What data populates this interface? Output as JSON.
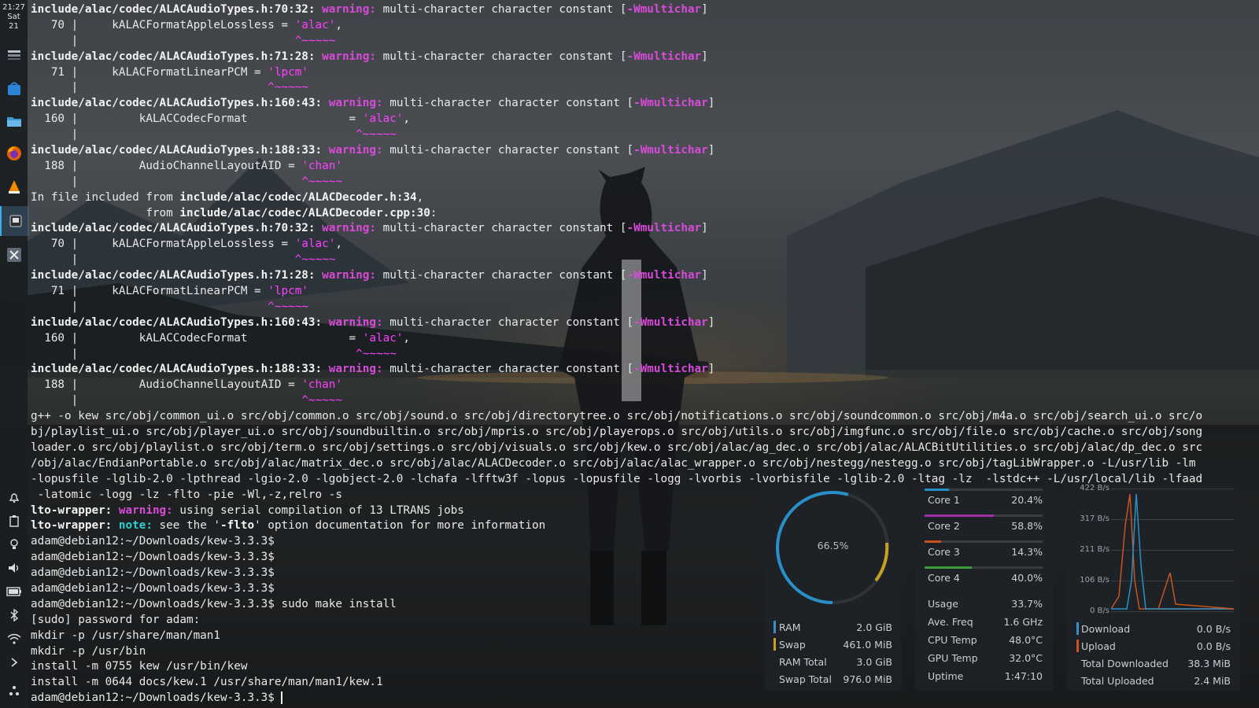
{
  "clock": {
    "time": "21:27",
    "day": "Sat",
    "date": "21"
  },
  "taskbar": {
    "top_icons": [
      "system-settings-icon",
      "discover-store-icon",
      "file-manager-icon",
      "firefox-icon",
      "vlc-icon",
      "terminal-icon",
      "x-app-icon"
    ],
    "tray_icons": [
      "notifications-icon",
      "clipboard-icon",
      "night-light-icon",
      "volume-icon",
      "battery-icon",
      "bluetooth-icon",
      "wifi-icon",
      "expand-tray-icon",
      "plasma-menu-icon"
    ]
  },
  "colors": {
    "warning": "#d84ad8",
    "note": "#2fd0d0",
    "quote": "#ff40ff",
    "accent": "#3daee9",
    "core1": "#2a8fc8",
    "core2": "#a02fa8",
    "core3": "#c8541e",
    "core4": "#3a9a3a"
  },
  "terminal": {
    "lines": [
      [
        {
          "t": "include/alac/codec/ALACAudioTypes.h:70:32: ",
          "c": "b"
        },
        {
          "t": "warning:",
          "c": "w"
        },
        {
          "t": " multi-character character constant ["
        },
        {
          "t": "-Wmultichar",
          "c": "w"
        },
        {
          "t": "]"
        }
      ],
      [
        {
          "t": "   70 |     kALACFormatAppleLossless = "
        },
        {
          "t": "'alac'",
          "c": "m"
        },
        {
          "t": ","
        }
      ],
      [
        {
          "t": "      |                                "
        },
        {
          "t": "^~~~~~",
          "c": "m"
        }
      ],
      [
        {
          "t": "include/alac/codec/ALACAudioTypes.h:71:28: ",
          "c": "b"
        },
        {
          "t": "warning:",
          "c": "w"
        },
        {
          "t": " multi-character character constant ["
        },
        {
          "t": "-Wmultichar",
          "c": "w"
        },
        {
          "t": "]"
        }
      ],
      [
        {
          "t": "   71 |     kALACFormatLinearPCM = "
        },
        {
          "t": "'lpcm'",
          "c": "m"
        }
      ],
      [
        {
          "t": "      |                            "
        },
        {
          "t": "^~~~~~",
          "c": "m"
        }
      ],
      [
        {
          "t": "include/alac/codec/ALACAudioTypes.h:160:43: ",
          "c": "b"
        },
        {
          "t": "warning:",
          "c": "w"
        },
        {
          "t": " multi-character character constant ["
        },
        {
          "t": "-Wmultichar",
          "c": "w"
        },
        {
          "t": "]"
        }
      ],
      [
        {
          "t": "  160 |         kALACCodecFormat               = "
        },
        {
          "t": "'alac'",
          "c": "m"
        },
        {
          "t": ","
        }
      ],
      [
        {
          "t": "      |                                         "
        },
        {
          "t": "^~~~~~",
          "c": "m"
        }
      ],
      [
        {
          "t": "include/alac/codec/ALACAudioTypes.h:188:33: ",
          "c": "b"
        },
        {
          "t": "warning:",
          "c": "w"
        },
        {
          "t": " multi-character character constant ["
        },
        {
          "t": "-Wmultichar",
          "c": "w"
        },
        {
          "t": "]"
        }
      ],
      [
        {
          "t": "  188 |         AudioChannelLayoutAID = "
        },
        {
          "t": "'chan'",
          "c": "m"
        }
      ],
      [
        {
          "t": "      |                                 "
        },
        {
          "t": "^~~~~~",
          "c": "m"
        }
      ],
      [
        {
          "t": "In file included from "
        },
        {
          "t": "include/alac/codec/ALACDecoder.h:34",
          "c": "b"
        },
        {
          "t": ","
        }
      ],
      [
        {
          "t": "                 from "
        },
        {
          "t": "include/alac/codec/ALACDecoder.cpp:30",
          "c": "b"
        },
        {
          "t": ":"
        }
      ],
      [
        {
          "t": "include/alac/codec/ALACAudioTypes.h:70:32: ",
          "c": "b"
        },
        {
          "t": "warning:",
          "c": "w"
        },
        {
          "t": " multi-character character constant ["
        },
        {
          "t": "-Wmultichar",
          "c": "w"
        },
        {
          "t": "]"
        }
      ],
      [
        {
          "t": "   70 |     kALACFormatAppleLossless = "
        },
        {
          "t": "'alac'",
          "c": "m"
        },
        {
          "t": ","
        }
      ],
      [
        {
          "t": "      |                                "
        },
        {
          "t": "^~~~~~",
          "c": "m"
        }
      ],
      [
        {
          "t": "include/alac/codec/ALACAudioTypes.h:71:28: ",
          "c": "b"
        },
        {
          "t": "warning:",
          "c": "w"
        },
        {
          "t": " multi-character character constant ["
        },
        {
          "t": "-Wmultichar",
          "c": "w"
        },
        {
          "t": "]"
        }
      ],
      [
        {
          "t": "   71 |     kALACFormatLinearPCM = "
        },
        {
          "t": "'lpcm'",
          "c": "m"
        }
      ],
      [
        {
          "t": "      |                            "
        },
        {
          "t": "^~~~~~",
          "c": "m"
        }
      ],
      [
        {
          "t": "include/alac/codec/ALACAudioTypes.h:160:43: ",
          "c": "b"
        },
        {
          "t": "warning:",
          "c": "w"
        },
        {
          "t": " multi-character character constant ["
        },
        {
          "t": "-Wmultichar",
          "c": "w"
        },
        {
          "t": "]"
        }
      ],
      [
        {
          "t": "  160 |         kALACCodecFormat               = "
        },
        {
          "t": "'alac'",
          "c": "m"
        },
        {
          "t": ","
        }
      ],
      [
        {
          "t": "      |                                         "
        },
        {
          "t": "^~~~~~",
          "c": "m"
        }
      ],
      [
        {
          "t": "include/alac/codec/ALACAudioTypes.h:188:33: ",
          "c": "b"
        },
        {
          "t": "warning:",
          "c": "w"
        },
        {
          "t": " multi-character character constant ["
        },
        {
          "t": "-Wmultichar",
          "c": "w"
        },
        {
          "t": "]"
        }
      ],
      [
        {
          "t": "  188 |         AudioChannelLayoutAID = "
        },
        {
          "t": "'chan'",
          "c": "m"
        }
      ],
      [
        {
          "t": "      |                                 "
        },
        {
          "t": "^~~~~~",
          "c": "m"
        }
      ],
      [
        {
          "t": "g++ -o kew src/obj/common_ui.o src/obj/common.o src/obj/sound.o src/obj/directorytree.o src/obj/notifications.o src/obj/soundcommon.o src/obj/m4a.o src/obj/search_ui.o src/o"
        }
      ],
      [
        {
          "t": "bj/playlist_ui.o src/obj/player_ui.o src/obj/soundbuiltin.o src/obj/mpris.o src/obj/playerops.o src/obj/utils.o src/obj/imgfunc.o src/obj/file.o src/obj/cache.o src/obj/song"
        }
      ],
      [
        {
          "t": "loader.o src/obj/playlist.o src/obj/term.o src/obj/settings.o src/obj/visuals.o src/obj/kew.o src/obj/alac/ag_dec.o src/obj/alac/ALACBitUtilities.o src/obj/alac/dp_dec.o src"
        }
      ],
      [
        {
          "t": "/obj/alac/EndianPortable.o src/obj/alac/matrix_dec.o src/obj/alac/ALACDecoder.o src/obj/alac/alac_wrapper.o src/obj/nestegg/nestegg.o src/obj/tagLibWrapper.o -L/usr/lib -lm"
        }
      ],
      [
        {
          "t": "-lopusfile -lglib-2.0 -lpthread -lgio-2.0 -lgobject-2.0 -lchafa -lfftw3f -lopus -lopusfile -logg -lvorbis -lvorbisfile -lglib-2.0 -ltag -lz  -lstdc++ -L/usr/local/lib -lfaad"
        }
      ],
      [
        {
          "t": " -latomic -logg -lz -flto -pie -Wl,-z,relro -s"
        }
      ],
      [
        {
          "t": "lto-wrapper: ",
          "c": "b"
        },
        {
          "t": "warning:",
          "c": "w"
        },
        {
          "t": " using serial compilation of 13 LTRANS jobs"
        }
      ],
      [
        {
          "t": "lto-wrapper: ",
          "c": "b"
        },
        {
          "t": "note:",
          "c": "n"
        },
        {
          "t": " see the '"
        },
        {
          "t": "-flto",
          "c": "b"
        },
        {
          "t": "' option documentation for more information"
        }
      ],
      [
        {
          "t": "adam@debian12:~/Downloads/kew-3.3.3$"
        }
      ],
      [
        {
          "t": "adam@debian12:~/Downloads/kew-3.3.3$"
        }
      ],
      [
        {
          "t": "adam@debian12:~/Downloads/kew-3.3.3$"
        }
      ],
      [
        {
          "t": "adam@debian12:~/Downloads/kew-3.3.3$"
        }
      ],
      [
        {
          "t": "adam@debian12:~/Downloads/kew-3.3.3$ sudo make install"
        }
      ],
      [
        {
          "t": "[sudo] password for adam:"
        }
      ],
      [
        {
          "t": "mkdir -p /usr/share/man/man1"
        }
      ],
      [
        {
          "t": "mkdir -p /usr/bin"
        }
      ],
      [
        {
          "t": "install -m 0755 kew /usr/bin/kew"
        }
      ],
      [
        {
          "t": "install -m 0644 docs/kew.1 /usr/share/man/man1/kew.1"
        }
      ],
      [
        {
          "t": "adam@debian12:~/Downloads/kew-3.3.3$ "
        },
        {
          "t": "",
          "c": "cursor"
        }
      ]
    ]
  },
  "memory_widget": {
    "gauge_label": "66.5%",
    "gauge_value": 0.665,
    "rows": [
      {
        "label": "RAM",
        "value": "2.0 GiB",
        "marker": "#3a8fc8"
      },
      {
        "label": "Swap",
        "value": "461.0 MiB",
        "marker": "#c8a020"
      },
      {
        "label": "RAM Total",
        "value": "3.0 GiB"
      },
      {
        "label": "Swap Total",
        "value": "976.0 MiB"
      }
    ]
  },
  "cpu_widget": {
    "cores": [
      {
        "label": "Core 1",
        "value": "20.4%",
        "pct": 0.204
      },
      {
        "label": "Core 2",
        "value": "58.8%",
        "pct": 0.588
      },
      {
        "label": "Core 3",
        "value": "14.3%",
        "pct": 0.143
      },
      {
        "label": "Core 4",
        "value": "40.0%",
        "pct": 0.4
      }
    ],
    "stats": [
      {
        "label": "Usage",
        "value": "33.7%"
      },
      {
        "label": "Ave. Freq",
        "value": "1.6 GHz"
      },
      {
        "label": "CPU Temp",
        "value": "48.0°C"
      },
      {
        "label": "GPU Temp",
        "value": "32.0°C"
      },
      {
        "label": "Uptime",
        "value": "1:47:10"
      }
    ]
  },
  "network_widget": {
    "y_ticks": [
      "422 B/s",
      "317 B/s",
      "211 B/s",
      "106 B/s",
      "0 B/s"
    ],
    "rows": [
      {
        "label": "Download",
        "value": "0.0 B/s",
        "marker": "#3a8fc8"
      },
      {
        "label": "Upload",
        "value": "0.0 B/s",
        "marker": "#c8541e"
      },
      {
        "label": "Total Downloaded",
        "value": "38.3 MiB"
      },
      {
        "label": "Total Uploaded",
        "value": "2.4 MiB"
      }
    ]
  }
}
